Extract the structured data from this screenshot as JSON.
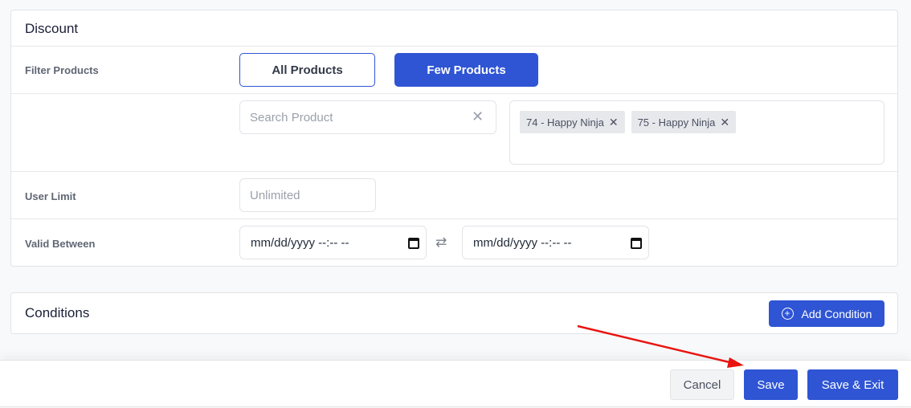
{
  "discount": {
    "title": "Discount",
    "filter_products": {
      "label": "Filter Products",
      "options": [
        "All Products",
        "Few Products"
      ],
      "selected": "Few Products"
    },
    "search": {
      "placeholder": "Search Product",
      "value": "",
      "clear_icon": "close-icon"
    },
    "selected_products": [
      {
        "label": "74 - Happy Ninja",
        "remove_icon": "close-icon"
      },
      {
        "label": "75 - Happy Ninja",
        "remove_icon": "close-icon"
      }
    ],
    "user_limit": {
      "label": "User Limit",
      "placeholder": "Unlimited",
      "value": ""
    },
    "valid_between": {
      "label": "Valid Between",
      "from_placeholder": "mm/dd/yyyy --:-- --",
      "to_placeholder": "mm/dd/yyyy --:-- --",
      "calendar_icon": "calendar-icon",
      "swap_icon": "swap-arrows-icon"
    }
  },
  "conditions": {
    "title": "Conditions",
    "add_button": "Add Condition",
    "add_icon": "plus-circle-icon"
  },
  "footer": {
    "cancel": "Cancel",
    "save": "Save",
    "save_exit": "Save & Exit"
  },
  "glyphs": {
    "close": "✕",
    "swap": "⇄",
    "plus": "+"
  },
  "colors": {
    "primary": "#2f55d4",
    "annotation": "#e8140f"
  }
}
